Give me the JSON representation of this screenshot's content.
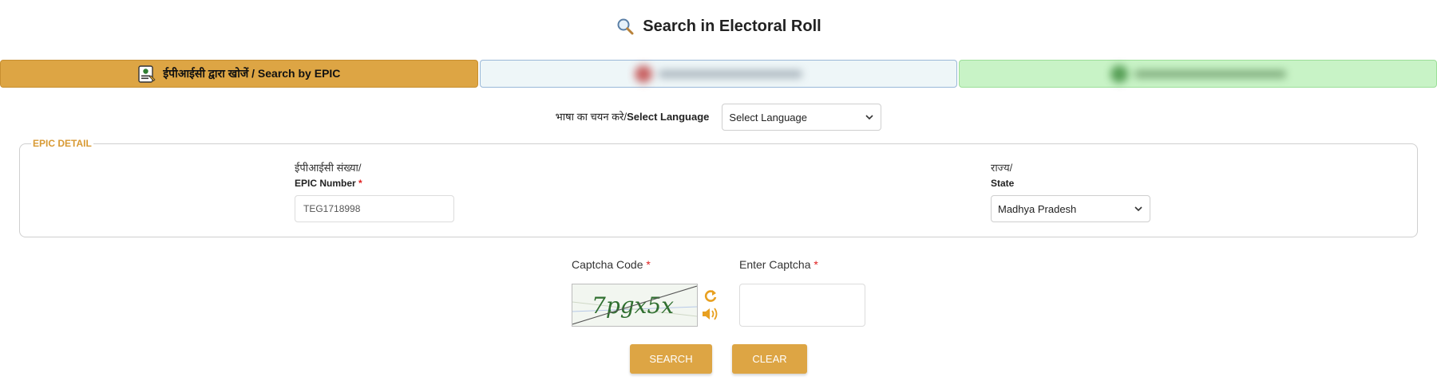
{
  "header": {
    "title": "Search in Electoral Roll",
    "icon": "search-icon"
  },
  "tabs": [
    {
      "label": "ईपीआईसी द्वारा खोजें / Search by EPIC",
      "icon": "epic-card-icon",
      "active": true
    }
  ],
  "language": {
    "label_hi": "भाषा का चयन करे/",
    "label_en": "Select Language",
    "selected": "Select Language"
  },
  "epic_detail": {
    "legend": "EPIC DETAIL",
    "epic_number": {
      "label_hi": "ईपीआईसी संख्या/",
      "label_en": "EPIC Number",
      "required_mark": "*",
      "value": "TEG1718998"
    },
    "state": {
      "label_hi": "राज्य/",
      "label_en": "State",
      "selected": "Madhya Pradesh"
    }
  },
  "captcha": {
    "code_label": "Captcha Code",
    "enter_label": "Enter Captcha",
    "required_mark": "*",
    "image_text": "7pgx5x",
    "refresh_icon": "refresh-icon",
    "audio_icon": "speaker-icon",
    "entry_value": ""
  },
  "buttons": {
    "search": "SEARCH",
    "clear": "CLEAR"
  },
  "colors": {
    "accent": "#dda544",
    "legend": "#d89a34",
    "required": "#e02020",
    "tab2_bg": "#eef6f8",
    "tab3_bg": "#c8f3c6"
  }
}
